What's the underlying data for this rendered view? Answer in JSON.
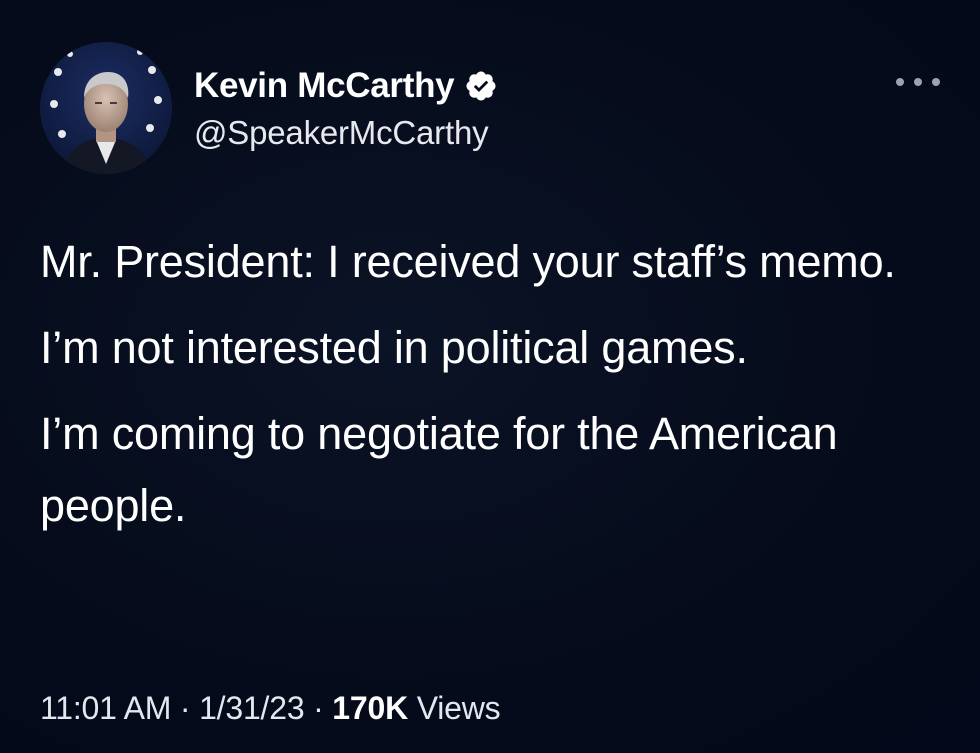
{
  "author": {
    "display_name": "Kevin McCarthy",
    "handle": "@SpeakerMcCarthy",
    "verified_icon": "verified-badge-icon",
    "avatar": "profile-photo"
  },
  "menu": {
    "icon": "more-horizontal-icon"
  },
  "tweet": {
    "paragraphs": [
      "Mr. President: I received your staff’s memo.",
      "I’m not interested in political games.",
      "I’m coming to negotiate for the American people."
    ]
  },
  "meta": {
    "time": "11:01 AM",
    "separator": " · ",
    "date": "1/31/23",
    "views_count": "170K",
    "views_label": " Views"
  },
  "colors": {
    "background": "#040a19",
    "text": "#ffffff",
    "verified": "#ffffff"
  }
}
